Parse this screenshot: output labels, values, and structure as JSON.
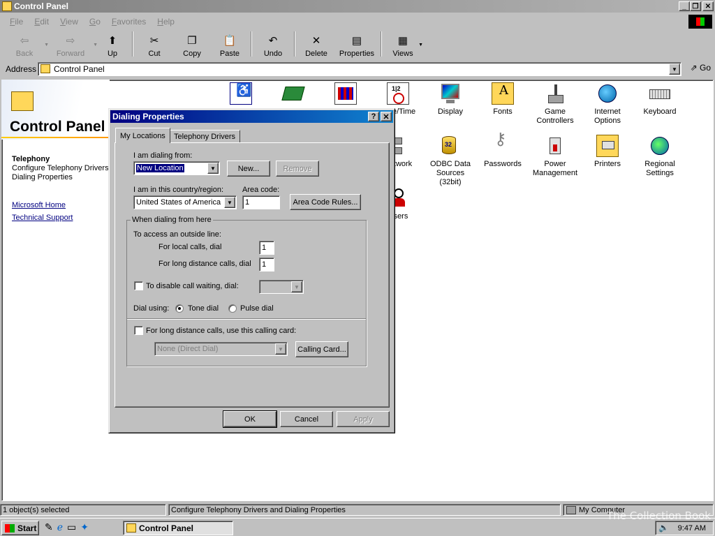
{
  "window": {
    "title": "Control Panel"
  },
  "menu": [
    "File",
    "Edit",
    "View",
    "Go",
    "Favorites",
    "Help"
  ],
  "toolbar": {
    "back": "Back",
    "forward": "Forward",
    "up": "Up",
    "cut": "Cut",
    "copy": "Copy",
    "paste": "Paste",
    "undo": "Undo",
    "delete": "Delete",
    "properties": "Properties",
    "views": "Views"
  },
  "address": {
    "label": "Address",
    "value": "Control Panel",
    "go": "Go"
  },
  "left_panel": {
    "heading": "Control Panel",
    "item_title": "Telephony",
    "item_desc": "Configure Telephony Drivers and Dialing Properties",
    "links": [
      "Microsoft Home",
      "Technical Support"
    ]
  },
  "icons": [
    {
      "label": "Date/Time",
      "icon": "datetime-icon"
    },
    {
      "label": "Display",
      "icon": "display-icon"
    },
    {
      "label": "Fonts",
      "icon": "fonts-icon"
    },
    {
      "label": "Game Controllers",
      "icon": "joystick-icon"
    },
    {
      "label": "Internet Options",
      "icon": "globe-icon"
    },
    {
      "label": "Keyboard",
      "icon": "keyboard-icon"
    },
    {
      "label": "Network",
      "icon": "network-icon"
    },
    {
      "label": "ODBC Data Sources (32bit)",
      "icon": "odbc-icon"
    },
    {
      "label": "Passwords",
      "icon": "keys-icon"
    },
    {
      "label": "Power Management",
      "icon": "power-icon"
    },
    {
      "label": "Printers",
      "icon": "printers-icon"
    },
    {
      "label": "Regional Settings",
      "icon": "globe-icon"
    },
    {
      "label": "Users",
      "icon": "users-icon"
    }
  ],
  "status": {
    "left": "1 object(s) selected",
    "middle": "Configure Telephony Drivers and Dialing Properties",
    "right": "My Computer"
  },
  "taskbar": {
    "start": "Start",
    "task": "Control Panel",
    "clock": "9:47 AM"
  },
  "dialog": {
    "title": "Dialing Properties",
    "tabs": [
      "My Locations",
      "Telephony Drivers"
    ],
    "dialing_from_label": "I am dialing from:",
    "location_value": "New Location",
    "new_btn": "New...",
    "remove_btn": "Remove",
    "country_label": "I am in this country/region:",
    "country_value": "United States of America",
    "area_code_label": "Area code:",
    "area_code_value": "1",
    "area_code_rules_btn": "Area Code Rules...",
    "group_title": "When dialing from here",
    "outside_line_label": "To access an outside line:",
    "local_label": "For local calls, dial",
    "local_value": "1",
    "long_label": "For long distance calls, dial",
    "long_value": "1",
    "call_waiting_label": "To disable call waiting, dial:",
    "dial_using_label": "Dial using:",
    "tone_label": "Tone dial",
    "pulse_label": "Pulse dial",
    "calling_card_label": "For long distance calls, use this calling card:",
    "calling_card_value": "None (Direct Dial)",
    "calling_card_btn": "Calling Card...",
    "ok": "OK",
    "cancel": "Cancel",
    "apply": "Apply"
  },
  "watermark": "The Collection Book"
}
